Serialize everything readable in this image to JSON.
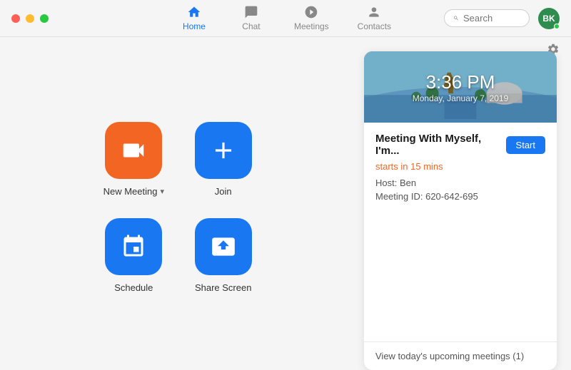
{
  "titlebar": {
    "nav_tabs": [
      {
        "id": "home",
        "label": "Home",
        "active": true
      },
      {
        "id": "chat",
        "label": "Chat",
        "active": false
      },
      {
        "id": "meetings",
        "label": "Meetings",
        "active": false
      },
      {
        "id": "contacts",
        "label": "Contacts",
        "active": false
      }
    ],
    "search_placeholder": "Search",
    "avatar_initials": "BK"
  },
  "actions": [
    {
      "id": "new-meeting",
      "label": "New Meeting",
      "has_chevron": true,
      "icon": "video",
      "color": "orange"
    },
    {
      "id": "join",
      "label": "Join",
      "has_chevron": false,
      "icon": "plus",
      "color": "blue"
    },
    {
      "id": "schedule",
      "label": "Schedule",
      "has_chevron": false,
      "icon": "calendar",
      "color": "blue"
    },
    {
      "id": "share-screen",
      "label": "Share Screen",
      "has_chevron": false,
      "icon": "share",
      "color": "blue"
    }
  ],
  "meeting_card": {
    "banner_time": "3:36 PM",
    "banner_date": "Monday, January 7, 2019",
    "title": "Meeting With Myself, I'm...",
    "start_label": "Start",
    "status": "starts in 15 mins",
    "host_label": "Host: Ben",
    "meeting_id_label": "Meeting ID: 620-642-695",
    "footer_text": "View today's upcoming meetings (1)"
  },
  "settings": {
    "icon_label": "⚙"
  }
}
